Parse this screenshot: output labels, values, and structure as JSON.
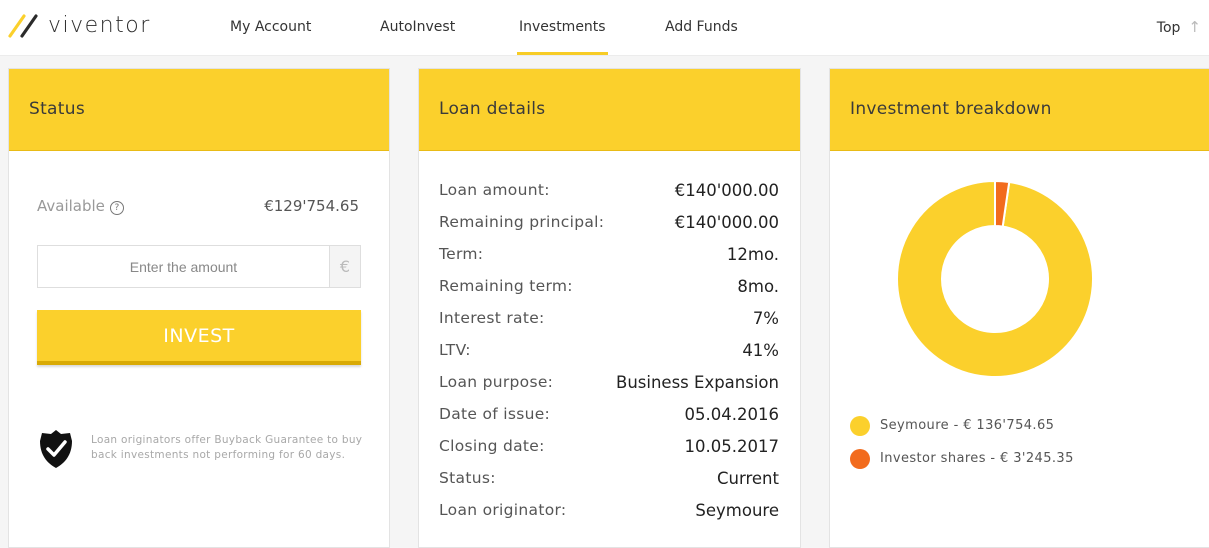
{
  "brand": {
    "name": "viventor",
    "accent": "#fbd02c"
  },
  "nav": {
    "items": [
      "My Account",
      "AutoInvest",
      "Investments",
      "Add Funds"
    ],
    "active": "Investments",
    "top_label": "Top",
    "top_icon": "arrow-up-icon"
  },
  "status": {
    "title": "Status",
    "available_label": "Available",
    "available_help_icon": "question-circle-icon",
    "available_value": "€129'754.65",
    "amount_placeholder": "Enter the amount",
    "amount_value": "",
    "currency": "€",
    "invest_label": "INVEST",
    "guarantee_icon": "shield-check-icon",
    "guarantee_text": "Loan originators offer Buyback Guarantee to buy back investments not performing for 60 days."
  },
  "loan": {
    "title": "Loan details",
    "rows": [
      {
        "label": "Loan amount:",
        "value": "€140'000.00"
      },
      {
        "label": "Remaining principal:",
        "value": "€140'000.00"
      },
      {
        "label": "Term:",
        "value": "12mo."
      },
      {
        "label": "Remaining term:",
        "value": "8mo."
      },
      {
        "label": "Interest rate:",
        "value": "7%"
      },
      {
        "label": "LTV:",
        "value": "41%"
      },
      {
        "label": "Loan purpose:",
        "value": "Business Expansion"
      },
      {
        "label": "Date of issue:",
        "value": "05.04.2016"
      },
      {
        "label": "Closing date:",
        "value": "10.05.2017"
      },
      {
        "label": "Status:",
        "value": "Current"
      },
      {
        "label": "Loan originator:",
        "value": "Seymoure"
      }
    ]
  },
  "breakdown": {
    "title": "Investment breakdown",
    "legend": [
      {
        "label": "Seymoure - € 136'754.65",
        "color": "#fbd02c"
      },
      {
        "label": "Investor shares - € 3'245.35",
        "color": "#f26b1d"
      }
    ]
  },
  "chart_data": {
    "type": "pie",
    "categories": [
      "Seymoure",
      "Investor shares"
    ],
    "values": [
      136754.65,
      3245.35
    ],
    "colors": [
      "#fbd02c",
      "#f26b1d"
    ],
    "title": ""
  }
}
